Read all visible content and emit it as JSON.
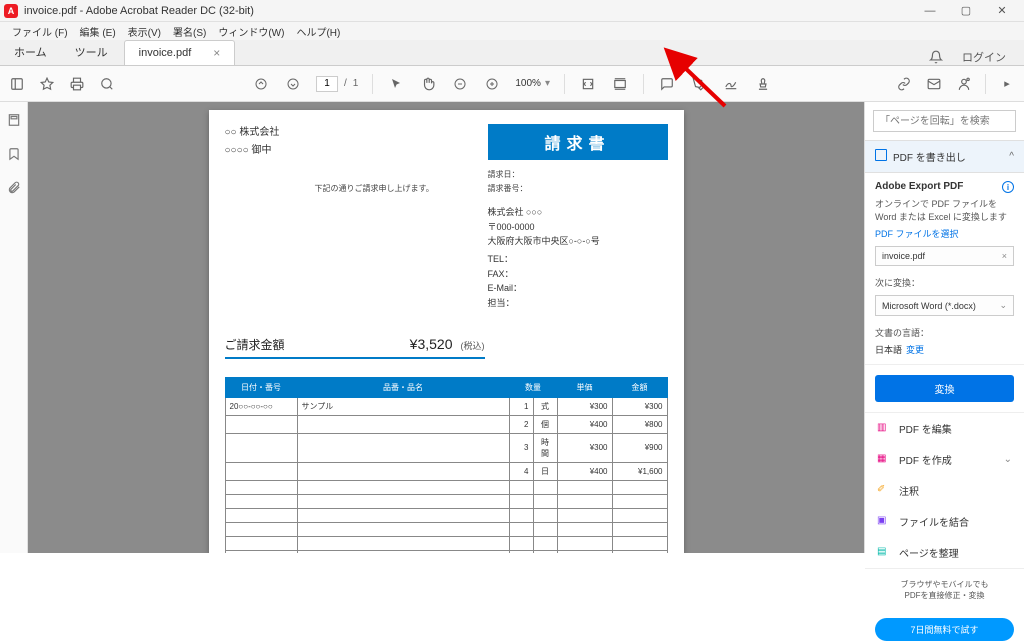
{
  "window": {
    "title": "invoice.pdf - Adobe Acrobat Reader DC (32-bit)"
  },
  "menu": {
    "file": "ファイル (F)",
    "edit": "編集 (E)",
    "view": "表示(V)",
    "sign": "署名(S)",
    "window": "ウィンドウ(W)",
    "help": "ヘルプ(H)"
  },
  "tabs": {
    "home": "ホーム",
    "tools": "ツール",
    "doc": "invoice.pdf",
    "login": "ログイン"
  },
  "toolbar": {
    "page_current": "1",
    "page_sep": "/",
    "page_total": "1",
    "zoom": "100%"
  },
  "invoice": {
    "title": "請求書",
    "to_company": "○○  株式会社",
    "to_dept": "○○○○   御中",
    "note": "下記の通りご請求申し上げます。",
    "meta_date_lbl": "請求日：",
    "meta_no_lbl": "請求番号：",
    "from_company": "株式会社 ○○○",
    "from_zip": "〒000-0000",
    "from_addr": "大阪府大阪市中央区○-○-○号",
    "tel_lbl": "TEL：",
    "fax_lbl": "FAX：",
    "email_lbl": "E-Mail：",
    "person_lbl": "担当：",
    "amount_lbl": "ご請求金額",
    "amount_val": "¥3,520",
    "amount_tax": "(税込)",
    "th_date": "日付・番号",
    "th_item": "品番・品名",
    "th_qty": "数量",
    "th_unit": "単価",
    "th_amt": "金額",
    "rows": [
      {
        "date": "20○○-○○-○○",
        "item": "サンプル",
        "qty": "1",
        "u": "式",
        "price": "¥300",
        "amt": "¥300"
      },
      {
        "date": "",
        "item": "",
        "qty": "2",
        "u": "個",
        "price": "¥400",
        "amt": "¥800"
      },
      {
        "date": "",
        "item": "",
        "qty": "3",
        "u": "時間",
        "price": "¥300",
        "amt": "¥900"
      },
      {
        "date": "",
        "item": "",
        "qty": "4",
        "u": "日",
        "price": "¥400",
        "amt": "¥1,600"
      }
    ]
  },
  "right": {
    "search_ph": "「ページを回転」を検索",
    "export_title": "PDF を書き出し",
    "adobe_export": "Adobe Export PDF",
    "export_desc": "オンラインで PDF ファイルを Word または Excel に変換します",
    "select_file": "PDF ファイルを選択",
    "cur_file": "invoice.pdf",
    "convert_to_lbl": "次に変換：",
    "convert_fmt": "Microsoft Word (*.docx)",
    "lang_lbl": "文書の言語：",
    "lang_val": "日本語",
    "lang_change": "変更",
    "convert_btn": "変換",
    "tool_edit": "PDF を編集",
    "tool_create": "PDF を作成",
    "tool_comment": "注釈",
    "tool_combine": "ファイルを結合",
    "tool_organize": "ページを整理",
    "footer1": "ブラウザやモバイルでも",
    "footer2": "PDFを直接修正・変換",
    "trial": "7日間無料で試す"
  }
}
